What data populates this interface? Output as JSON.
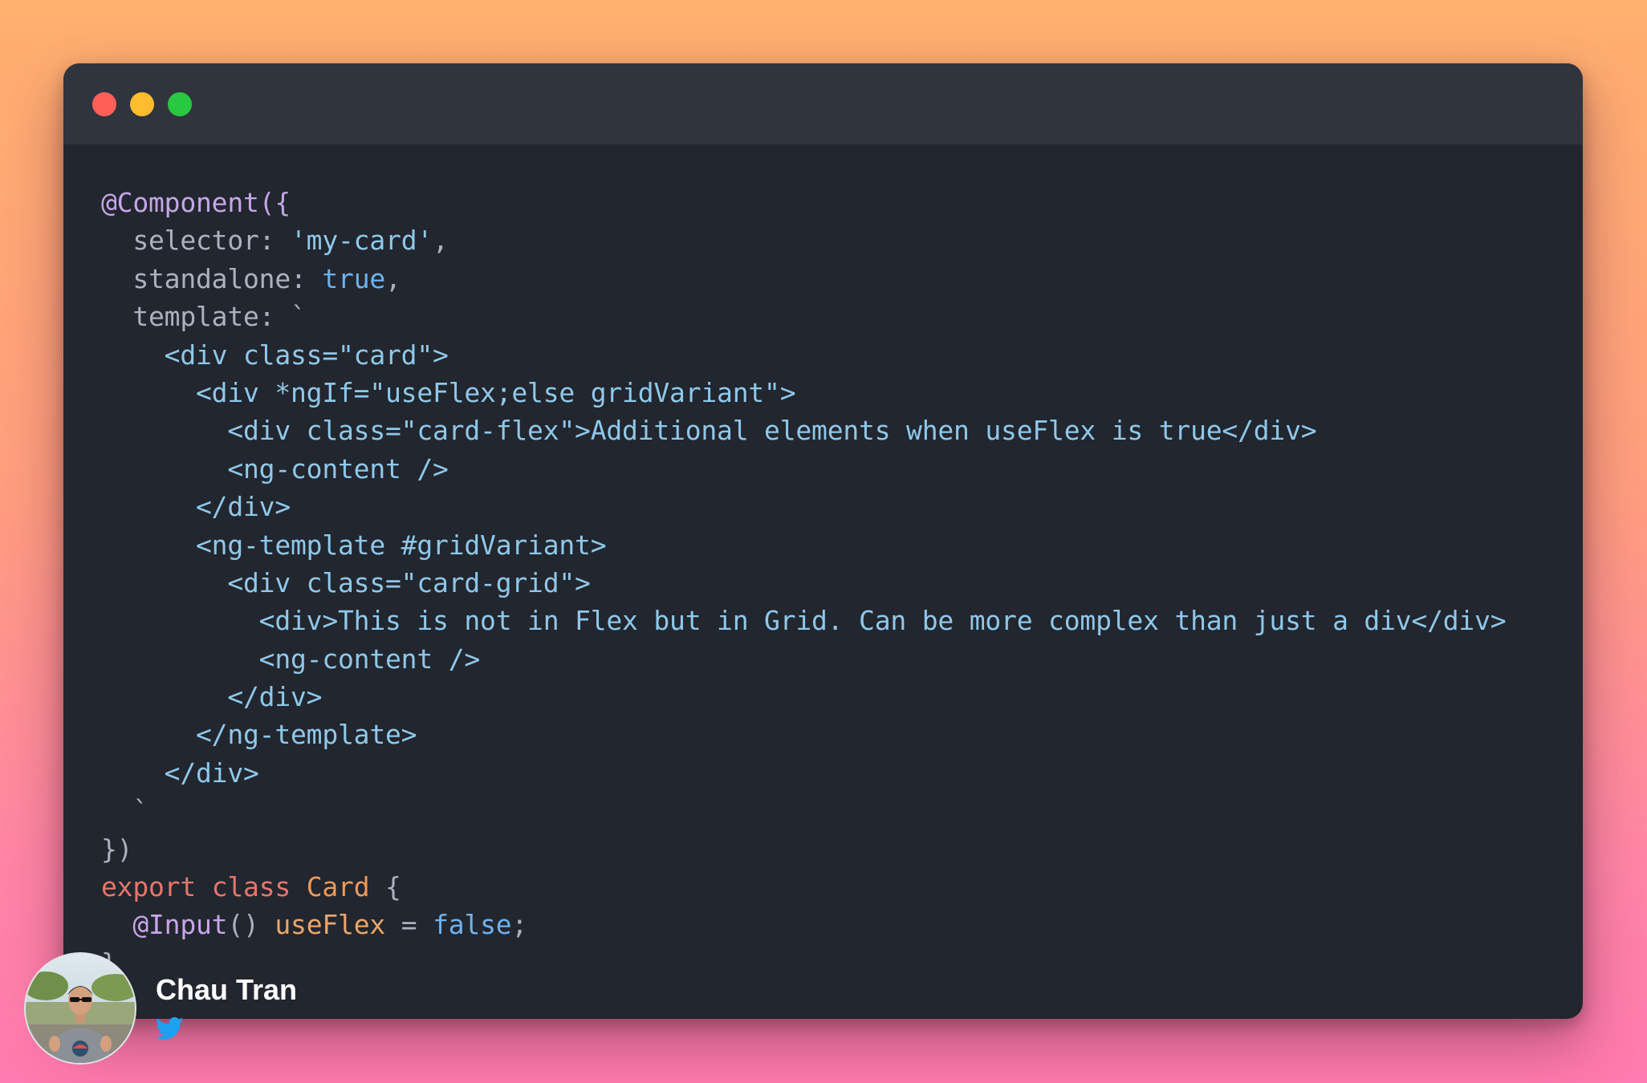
{
  "window": {
    "buttons": [
      "close",
      "minimize",
      "maximize"
    ]
  },
  "code": {
    "language": "typescript",
    "lines": [
      [
        {
          "t": "@Component({",
          "c": "dec"
        }
      ],
      [
        {
          "t": "  selector: ",
          "c": "plain"
        },
        {
          "t": "'my-card'",
          "c": "str"
        },
        {
          "t": ",",
          "c": "plain"
        }
      ],
      [
        {
          "t": "  standalone: ",
          "c": "plain"
        },
        {
          "t": "true",
          "c": "bool"
        },
        {
          "t": ",",
          "c": "plain"
        }
      ],
      [
        {
          "t": "  template: `",
          "c": "plain"
        }
      ],
      [
        {
          "t": "    <div class=\"card\">",
          "c": "str"
        }
      ],
      [
        {
          "t": "      <div *ngIf=\"useFlex;else gridVariant\">",
          "c": "str"
        }
      ],
      [
        {
          "t": "        <div class=\"card-flex\">Additional elements when useFlex is true</div>",
          "c": "str"
        }
      ],
      [
        {
          "t": "        <ng-content />",
          "c": "str"
        }
      ],
      [
        {
          "t": "      </div>",
          "c": "str"
        }
      ],
      [
        {
          "t": "      <ng-template #gridVariant>",
          "c": "str"
        }
      ],
      [
        {
          "t": "        <div class=\"card-grid\">",
          "c": "str"
        }
      ],
      [
        {
          "t": "          <div>This is not in Flex but in Grid. Can be more complex than just a div</div>",
          "c": "str"
        }
      ],
      [
        {
          "t": "          <ng-content />",
          "c": "str"
        }
      ],
      [
        {
          "t": "        </div>",
          "c": "str"
        }
      ],
      [
        {
          "t": "      </ng-template>",
          "c": "str"
        }
      ],
      [
        {
          "t": "    </div>",
          "c": "str"
        }
      ],
      [
        {
          "t": "  `",
          "c": "plain"
        }
      ],
      [
        {
          "t": "})",
          "c": "plain"
        }
      ],
      [
        {
          "t": "export",
          "c": "kw"
        },
        {
          "t": " ",
          "c": "plain"
        },
        {
          "t": "class",
          "c": "kw"
        },
        {
          "t": " ",
          "c": "plain"
        },
        {
          "t": "Card",
          "c": "cls"
        },
        {
          "t": " {",
          "c": "plain"
        }
      ],
      [
        {
          "t": "  @Input",
          "c": "dec"
        },
        {
          "t": "() ",
          "c": "plain"
        },
        {
          "t": "useFlex",
          "c": "prop"
        },
        {
          "t": " = ",
          "c": "plain"
        },
        {
          "t": "false",
          "c": "bool"
        },
        {
          "t": ";",
          "c": "plain"
        }
      ],
      [
        {
          "t": "}",
          "c": "plain"
        }
      ]
    ]
  },
  "author": {
    "name": "Chau Tran",
    "avatar_icon": "avatar-photo",
    "social_icon": "twitter-icon"
  },
  "colors": {
    "background_top": "#FFB06E",
    "background_bottom": "#FF7AAE",
    "editor_bg": "#22262E",
    "titlebar_bg": "#30343D",
    "close": "#FF5F57",
    "minimize": "#FEBC2E",
    "maximize": "#28C840",
    "twitter": "#1DA1F2"
  }
}
